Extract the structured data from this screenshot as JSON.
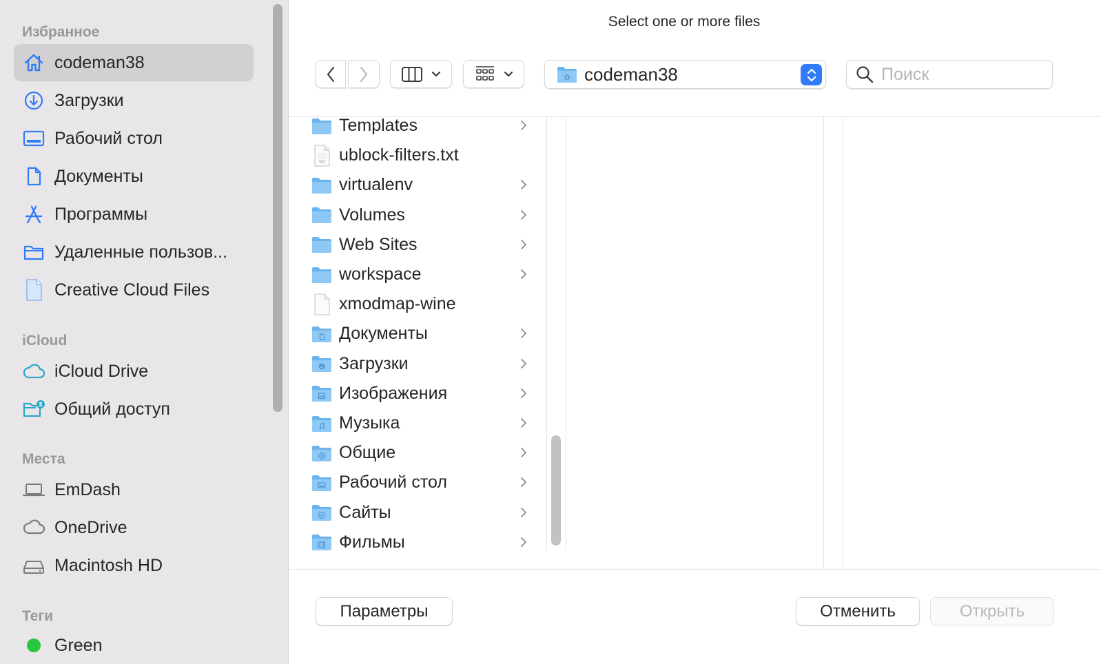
{
  "dialog": {
    "title": "Select one or more files"
  },
  "sidebar": {
    "sections": [
      {
        "label": "Избранное"
      },
      {
        "label": "iCloud"
      },
      {
        "label": "Места"
      },
      {
        "label": "Теги"
      }
    ],
    "favorites": [
      {
        "label": "codeman38",
        "icon": "home-icon",
        "selected": true
      },
      {
        "label": "Загрузки",
        "icon": "downloads-icon"
      },
      {
        "label": "Рабочий стол",
        "icon": "desktop-icon"
      },
      {
        "label": "Документы",
        "icon": "document-icon"
      },
      {
        "label": "Программы",
        "icon": "applications-icon"
      },
      {
        "label": "Удаленные пользов...",
        "icon": "folder-icon"
      },
      {
        "label": "Creative Cloud Files",
        "icon": "file-icon"
      }
    ],
    "icloud": [
      {
        "label": "iCloud Drive",
        "icon": "cloud-icon"
      },
      {
        "label": "Общий доступ",
        "icon": "shared-folder-icon"
      }
    ],
    "locations": [
      {
        "label": "EmDash",
        "icon": "laptop-icon"
      },
      {
        "label": "OneDrive",
        "icon": "cloud-icon"
      },
      {
        "label": "Macintosh HD",
        "icon": "hard-drive-icon"
      }
    ],
    "tags": [
      {
        "label": "Green",
        "color": "#28c840"
      }
    ]
  },
  "toolbar": {
    "path": "codeman38",
    "search_placeholder": "Поиск"
  },
  "column1": {
    "items": [
      {
        "name": "Templates",
        "icon": "folder-icon",
        "has_children": true
      },
      {
        "name": "ublock-filters.txt",
        "icon": "txt-file-icon",
        "has_children": false
      },
      {
        "name": "virtualenv",
        "icon": "folder-icon",
        "has_children": true
      },
      {
        "name": "Volumes",
        "icon": "folder-icon",
        "has_children": true
      },
      {
        "name": "Web Sites",
        "icon": "folder-icon",
        "has_children": true
      },
      {
        "name": "workspace",
        "icon": "folder-icon",
        "has_children": true
      },
      {
        "name": "xmodmap-wine",
        "icon": "blank-file-icon",
        "has_children": false
      },
      {
        "name": "Документы",
        "icon": "documents-folder-icon",
        "has_children": true
      },
      {
        "name": "Загрузки",
        "icon": "downloads-folder-icon",
        "has_children": true
      },
      {
        "name": "Изображения",
        "icon": "pictures-folder-icon",
        "has_children": true
      },
      {
        "name": "Музыка",
        "icon": "music-folder-icon",
        "has_children": true
      },
      {
        "name": "Общие",
        "icon": "public-folder-icon",
        "has_children": true
      },
      {
        "name": "Рабочий стол",
        "icon": "desktop-folder-icon",
        "has_children": true
      },
      {
        "name": "Сайты",
        "icon": "sites-folder-icon",
        "has_children": true
      },
      {
        "name": "Фильмы",
        "icon": "movies-folder-icon",
        "has_children": true
      }
    ]
  },
  "footer": {
    "options_label": "Параметры",
    "cancel_label": "Отменить",
    "open_label": "Открыть"
  },
  "colors": {
    "accent": "#2f7cf6",
    "folder": "#6cb4ee",
    "sidebar_bg": "#e9e6e9"
  }
}
